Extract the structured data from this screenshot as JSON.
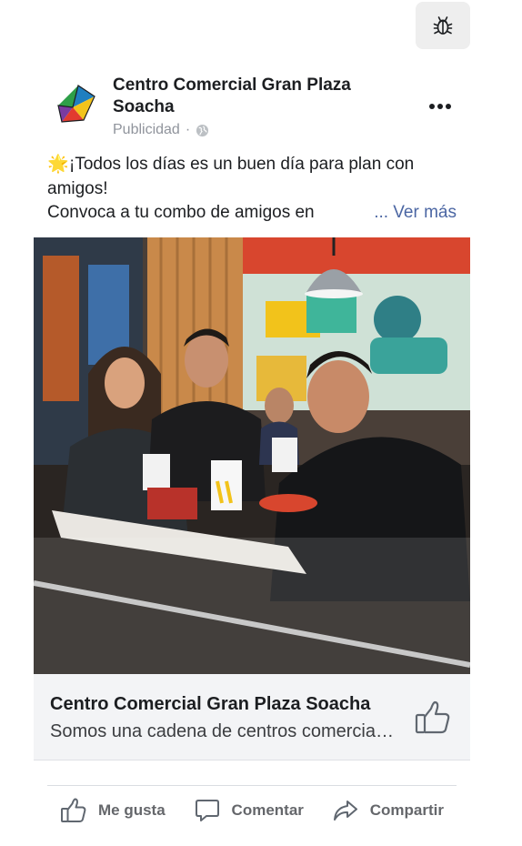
{
  "toolbar": {
    "debug_icon": "bug-icon"
  },
  "post": {
    "page_name": "Centro Comercial Gran Plaza Soacha",
    "sponsored_label": "Publicidad",
    "separator": "·",
    "privacy_icon": "globe-icon",
    "more_icon": "more-options-icon",
    "text": {
      "emoji": "🌟",
      "line1": "¡Todos los días es un buen día para plan con",
      "line2": "amigos!",
      "line3": "Convoca a tu combo de amigos en",
      "see_more": "... Ver más"
    },
    "image_icon": "photo"
  },
  "link_card": {
    "title": "Centro Comercial Gran Plaza Soacha",
    "description": "Somos una cadena de centros comerciales",
    "like_icon": "thumbs-up-icon"
  },
  "actions": {
    "like_label": "Me gusta",
    "comment_label": "Comentar",
    "share_label": "Compartir"
  },
  "colors": {
    "text": "#1c1e21",
    "muted": "#90949c",
    "link": "#4b66a3",
    "action": "#65676b",
    "card_bg": "#f3f4f6"
  }
}
